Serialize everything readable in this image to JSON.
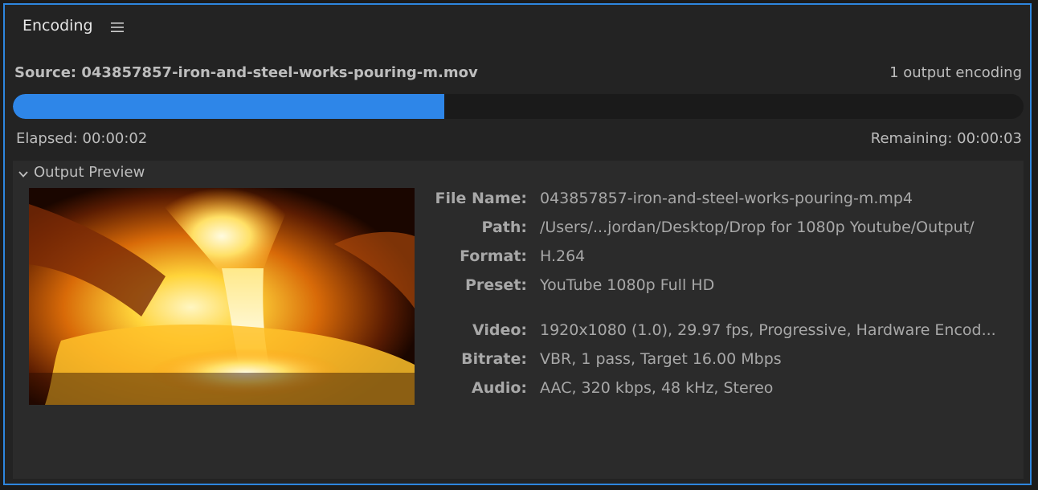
{
  "panel": {
    "title": "Encoding",
    "menu_icon": "hamburger-menu-icon"
  },
  "encoding": {
    "source": "Source: 043857857-iron-and-steel-works-pouring-m.mov",
    "output_count": "1 output encoding",
    "progress": 0.427,
    "elapsed": "Elapsed: 00:00:02",
    "remaining": "Remaining: 00:00:03"
  },
  "output_preview": {
    "header": "Output Preview",
    "chevron_icon": "chevron-down-icon",
    "rows": [
      {
        "label": "File Name:",
        "value": "043857857-iron-and-steel-works-pouring-m.mp4"
      },
      {
        "label": "Path:",
        "value": "/Users/...jordan/Desktop/Drop for 1080p Youtube/Output/"
      },
      {
        "label": "Format:",
        "value": "H.264"
      },
      {
        "label": "Preset:",
        "value": "YouTube 1080p Full HD"
      },
      {
        "label": "Video:",
        "value": "1920x1080 (1.0), 29.97 fps, Progressive, Hardware Encod..."
      },
      {
        "label": "Bitrate:",
        "value": "VBR, 1 pass, Target 16.00 Mbps"
      },
      {
        "label": "Audio:",
        "value": "AAC, 320 kbps, 48 kHz, Stereo"
      }
    ]
  },
  "colors": {
    "accent": "#2e86e8",
    "panel_border": "#2e86de",
    "background": "#232323",
    "section_background": "#2b2b2b"
  }
}
